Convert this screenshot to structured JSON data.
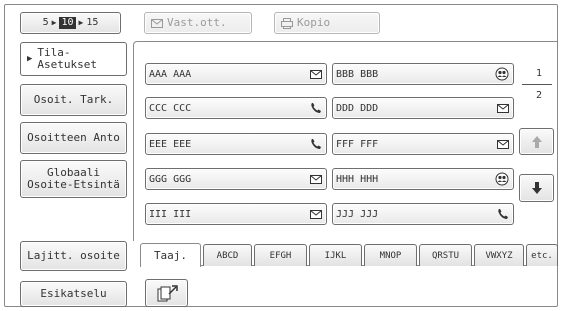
{
  "pager": {
    "prev_value": "5",
    "current_value": "10",
    "next_value": "15"
  },
  "top": {
    "fax_label": "Vast.ott.",
    "copy_label": "Kopio"
  },
  "sidebar": {
    "settings_label": "Tila-\nAsetukset",
    "check_label": "Osoit. Tark.",
    "entry_label": "Osoitteen Anto",
    "global_label": "Globaali\nOsoite-Etsintä",
    "sort_label": "Lajitt. osoite",
    "preview_label": "Esikatselu"
  },
  "addresses": [
    {
      "name": "AAA AAA",
      "icon": "mail-icon"
    },
    {
      "name": "BBB BBB",
      "icon": "group-icon"
    },
    {
      "name": "CCC CCC",
      "icon": "phone-icon"
    },
    {
      "name": "DDD DDD",
      "icon": "mail-icon"
    },
    {
      "name": "EEE EEE",
      "icon": "phone-icon"
    },
    {
      "name": "FFF FFF",
      "icon": "mail-icon"
    },
    {
      "name": "GGG GGG",
      "icon": "mail-icon"
    },
    {
      "name": "HHH HHH",
      "icon": "group-icon"
    },
    {
      "name": "III III",
      "icon": "mail-icon"
    },
    {
      "name": "JJJ JJJ",
      "icon": "phone-icon"
    }
  ],
  "page": {
    "current": "1",
    "total": "2"
  },
  "tabs": [
    "Taaj.",
    "ABCD",
    "EFGH",
    "IJKL",
    "MNOP",
    "QRSTU",
    "VWXYZ",
    "etc."
  ],
  "colors": {
    "border": "#6e6e6e",
    "disabled_text": "#9a9a9a"
  }
}
